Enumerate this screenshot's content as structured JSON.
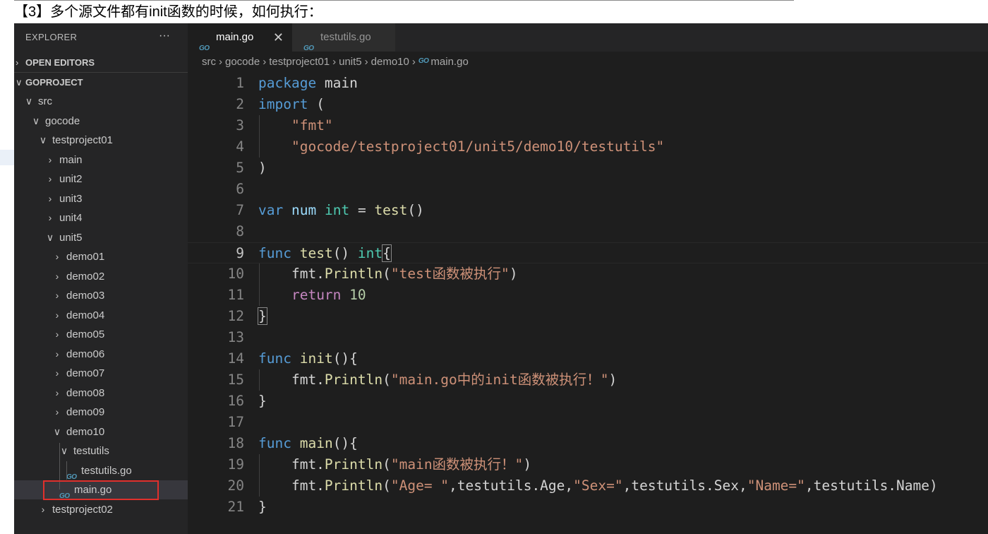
{
  "caption": "【3】多个源文件都有init函数的时候，如何执行：",
  "explorer": {
    "title": "EXPLORER",
    "more": "···",
    "open_editors": "OPEN EDITORS",
    "project": "GOPROJECT",
    "go_badge": "GO",
    "tree": [
      {
        "label": "src",
        "chev": "∨"
      },
      {
        "label": "gocode",
        "chev": "∨"
      },
      {
        "label": "testproject01",
        "chev": "∨"
      },
      {
        "label": "main",
        "chev": "›"
      },
      {
        "label": "unit2",
        "chev": "›"
      },
      {
        "label": "unit3",
        "chev": "›"
      },
      {
        "label": "unit4",
        "chev": "›"
      },
      {
        "label": "unit5",
        "chev": "∨"
      },
      {
        "label": "demo01",
        "chev": "›"
      },
      {
        "label": "demo02",
        "chev": "›"
      },
      {
        "label": "demo03",
        "chev": "›"
      },
      {
        "label": "demo04",
        "chev": "›"
      },
      {
        "label": "demo05",
        "chev": "›"
      },
      {
        "label": "demo06",
        "chev": "›"
      },
      {
        "label": "demo07",
        "chev": "›"
      },
      {
        "label": "demo08",
        "chev": "›"
      },
      {
        "label": "demo09",
        "chev": "›"
      },
      {
        "label": "demo10",
        "chev": "∨"
      },
      {
        "label": "testutils",
        "chev": "∨"
      },
      {
        "label": "testutils.go"
      },
      {
        "label": "main.go"
      },
      {
        "label": "testproject02",
        "chev": "›"
      }
    ]
  },
  "tabs": [
    {
      "label": "main.go",
      "close": "✕"
    },
    {
      "label": "testutils.go"
    }
  ],
  "breadcrumb": [
    "src",
    "gocode",
    "testproject01",
    "unit5",
    "demo10",
    "main.go"
  ],
  "breadcrumb_sep": "›",
  "code": {
    "line_numbers": [
      "1",
      "2",
      "3",
      "4",
      "5",
      "6",
      "7",
      "8",
      "9",
      "10",
      "11",
      "12",
      "13",
      "14",
      "15",
      "16",
      "17",
      "18",
      "19",
      "20",
      "21"
    ],
    "current_line": 9,
    "lines": [
      [
        {
          "t": "package",
          "c": "kw"
        },
        {
          "t": " main",
          "c": "txt"
        }
      ],
      [
        {
          "t": "import",
          "c": "kw"
        },
        {
          "t": " (",
          "c": "txt"
        }
      ],
      [
        {
          "t": "    ",
          "c": "txt"
        },
        {
          "t": "\"fmt\"",
          "c": "str"
        }
      ],
      [
        {
          "t": "    ",
          "c": "txt"
        },
        {
          "t": "\"gocode/testproject01/unit5/demo10/testutils\"",
          "c": "str"
        }
      ],
      [
        {
          "t": ")",
          "c": "txt"
        }
      ],
      [],
      [
        {
          "t": "var",
          "c": "kw"
        },
        {
          "t": " ",
          "c": "txt"
        },
        {
          "t": "num",
          "c": "var"
        },
        {
          "t": " ",
          "c": "txt"
        },
        {
          "t": "int",
          "c": "type"
        },
        {
          "t": " = ",
          "c": "txt"
        },
        {
          "t": "test",
          "c": "fn"
        },
        {
          "t": "()",
          "c": "txt"
        }
      ],
      [],
      [
        {
          "t": "func",
          "c": "kw"
        },
        {
          "t": " ",
          "c": "txt"
        },
        {
          "t": "test",
          "c": "fn"
        },
        {
          "t": "() ",
          "c": "txt"
        },
        {
          "t": "int",
          "c": "type"
        },
        {
          "t": "{",
          "c": "txt",
          "hl": true
        }
      ],
      [
        {
          "t": "    fmt.",
          "c": "txt"
        },
        {
          "t": "Println",
          "c": "fn"
        },
        {
          "t": "(",
          "c": "txt"
        },
        {
          "t": "\"test函数被执行\"",
          "c": "str"
        },
        {
          "t": ")",
          "c": "txt"
        }
      ],
      [
        {
          "t": "    ",
          "c": "txt"
        },
        {
          "t": "return",
          "c": "kw2"
        },
        {
          "t": " ",
          "c": "txt"
        },
        {
          "t": "10",
          "c": "num"
        }
      ],
      [
        {
          "t": "}",
          "c": "txt",
          "hl": true
        }
      ],
      [],
      [
        {
          "t": "func",
          "c": "kw"
        },
        {
          "t": " ",
          "c": "txt"
        },
        {
          "t": "init",
          "c": "fn"
        },
        {
          "t": "(){",
          "c": "txt"
        }
      ],
      [
        {
          "t": "    fmt.",
          "c": "txt"
        },
        {
          "t": "Println",
          "c": "fn"
        },
        {
          "t": "(",
          "c": "txt"
        },
        {
          "t": "\"main.go中的init函数被执行！\"",
          "c": "str"
        },
        {
          "t": ")",
          "c": "txt"
        }
      ],
      [
        {
          "t": "}",
          "c": "txt"
        }
      ],
      [],
      [
        {
          "t": "func",
          "c": "kw"
        },
        {
          "t": " ",
          "c": "txt"
        },
        {
          "t": "main",
          "c": "fn"
        },
        {
          "t": "(){",
          "c": "txt"
        }
      ],
      [
        {
          "t": "    fmt.",
          "c": "txt"
        },
        {
          "t": "Println",
          "c": "fn"
        },
        {
          "t": "(",
          "c": "txt"
        },
        {
          "t": "\"main函数被执行！\"",
          "c": "str"
        },
        {
          "t": ")",
          "c": "txt"
        }
      ],
      [
        {
          "t": "    fmt.",
          "c": "txt"
        },
        {
          "t": "Println",
          "c": "fn"
        },
        {
          "t": "(",
          "c": "txt"
        },
        {
          "t": "\"Age= \"",
          "c": "str"
        },
        {
          "t": ",testutils.Age,",
          "c": "txt"
        },
        {
          "t": "\"Sex=\"",
          "c": "str"
        },
        {
          "t": ",testutils.Sex,",
          "c": "txt"
        },
        {
          "t": "\"Name=\"",
          "c": "str"
        },
        {
          "t": ",testutils.Name)",
          "c": "txt"
        }
      ],
      [
        {
          "t": "}",
          "c": "txt"
        }
      ]
    ]
  }
}
